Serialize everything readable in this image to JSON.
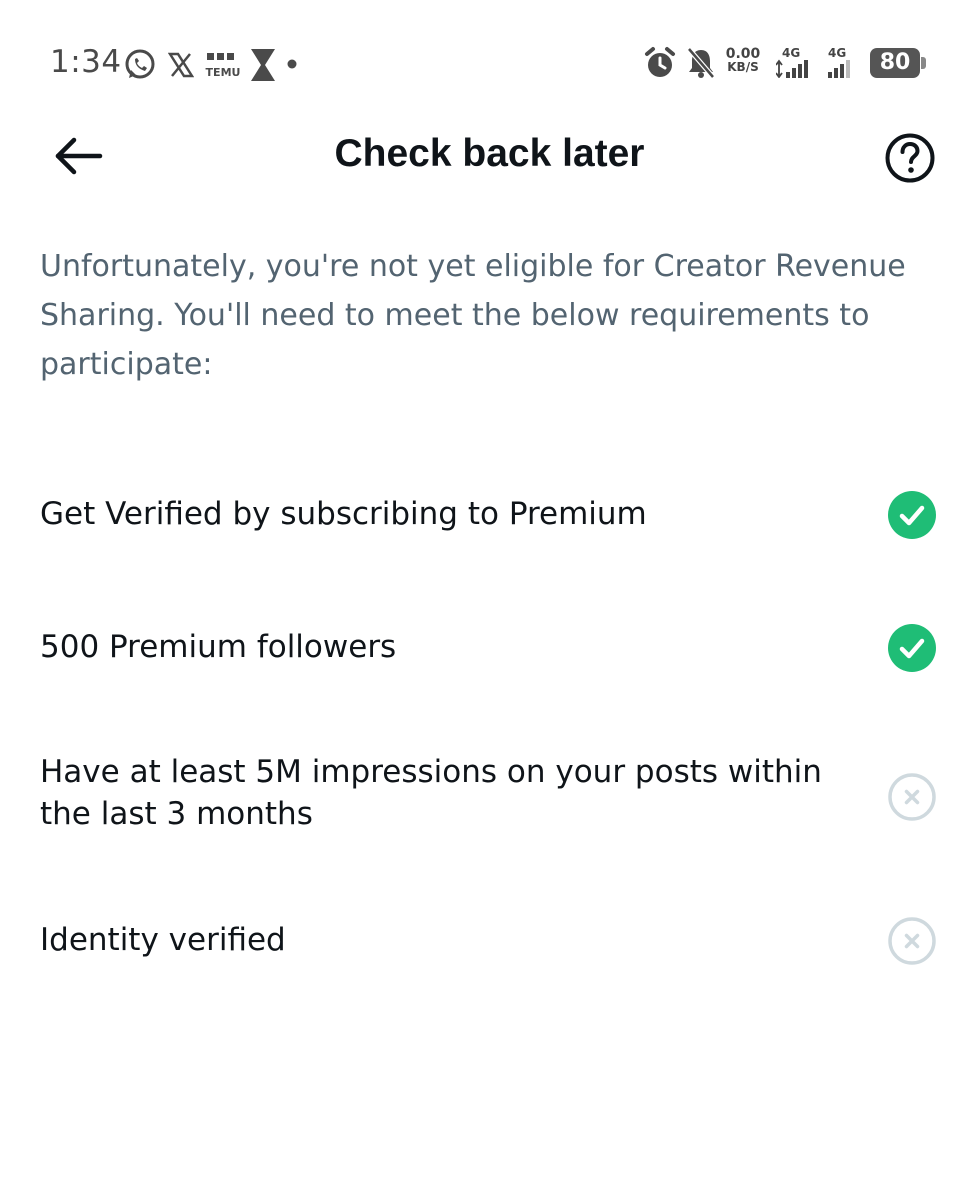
{
  "status_bar": {
    "time": "1:34",
    "app_icons": [
      "whatsapp-icon",
      "x-icon",
      "temu-icon",
      "hourglass-icon",
      "dot-icon"
    ],
    "net_speed_value": "0.00",
    "net_speed_unit": "KB/S",
    "network_1": "4G",
    "network_2": "4G",
    "battery": "80",
    "status_icons": [
      "alarm-icon",
      "bell-muted-icon"
    ]
  },
  "header": {
    "title": "Check back later",
    "back_icon": "back-arrow-icon",
    "help_icon": "help-icon"
  },
  "intro_text": "Unfortunately, you're not yet eligible for Creator Revenue Sharing. You'll need to meet the below requirements to participate:",
  "requirements": [
    {
      "label": "Get Verified by subscribing to Premium",
      "met": true
    },
    {
      "label": "500 Premium followers",
      "met": true
    },
    {
      "label": "Have at least 5M impressions on your posts within the last 3 months",
      "met": false
    },
    {
      "label": "Identity verified",
      "met": false
    }
  ],
  "colors": {
    "met": "#1fbd76",
    "unmet": "#cfd9de",
    "title": "#0f1419",
    "secondary_text": "#536471"
  }
}
